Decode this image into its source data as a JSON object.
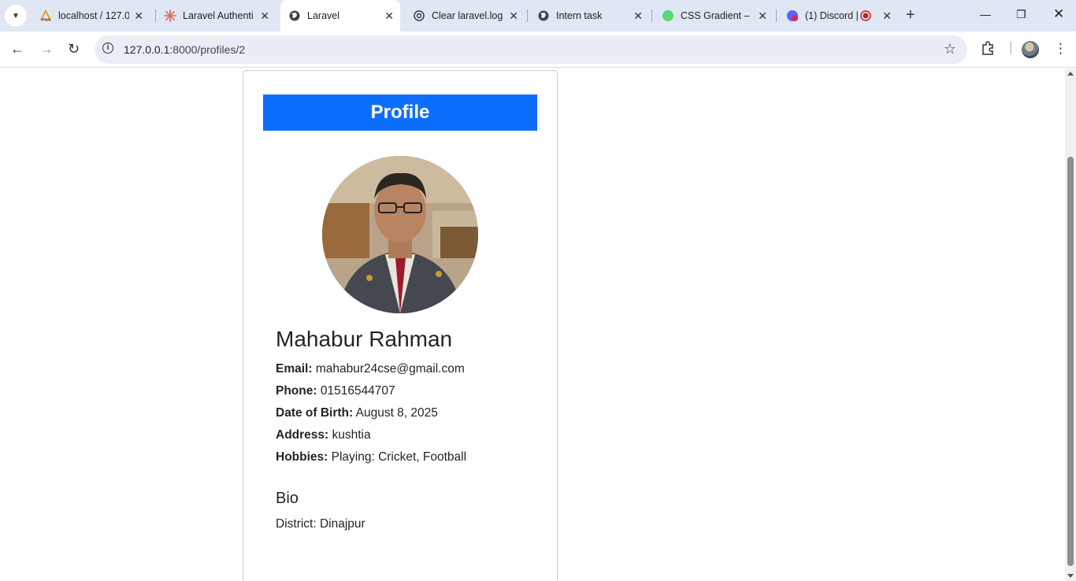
{
  "browser": {
    "tabs": [
      {
        "title": "localhost / 127.0",
        "icon": "phpmyadmin-icon"
      },
      {
        "title": "Laravel Authenti",
        "icon": "claude-icon"
      },
      {
        "title": "Laravel",
        "icon": "globe-icon",
        "active": true
      },
      {
        "title": "Clear laravel.log",
        "icon": "chatgpt-icon"
      },
      {
        "title": "Intern task",
        "icon": "globe-icon"
      },
      {
        "title": "CSS Gradient – C",
        "icon": "cssgradient-icon"
      },
      {
        "title": "(1) Discord |",
        "icon": "discord-icon"
      }
    ],
    "url_host": "127.0.0.1",
    "url_path": ":8000/profiles/2"
  },
  "profile": {
    "header": "Profile",
    "name": "Mahabur Rahman",
    "email_label": "Email:",
    "email": "mahabur24cse@gmail.com",
    "phone_label": "Phone:",
    "phone": "01516544707",
    "dob_label": "Date of Birth:",
    "dob": "August 8, 2025",
    "address_label": "Address:",
    "address": "kushtia",
    "hobbies_label": "Hobbies:",
    "hobbies": "Playing: Cricket, Football",
    "bio_heading": "Bio",
    "bio": "District: Dinajpur"
  },
  "colors": {
    "header_bg": "#0d6efd",
    "tabbar_bg": "#dfe7f5"
  }
}
